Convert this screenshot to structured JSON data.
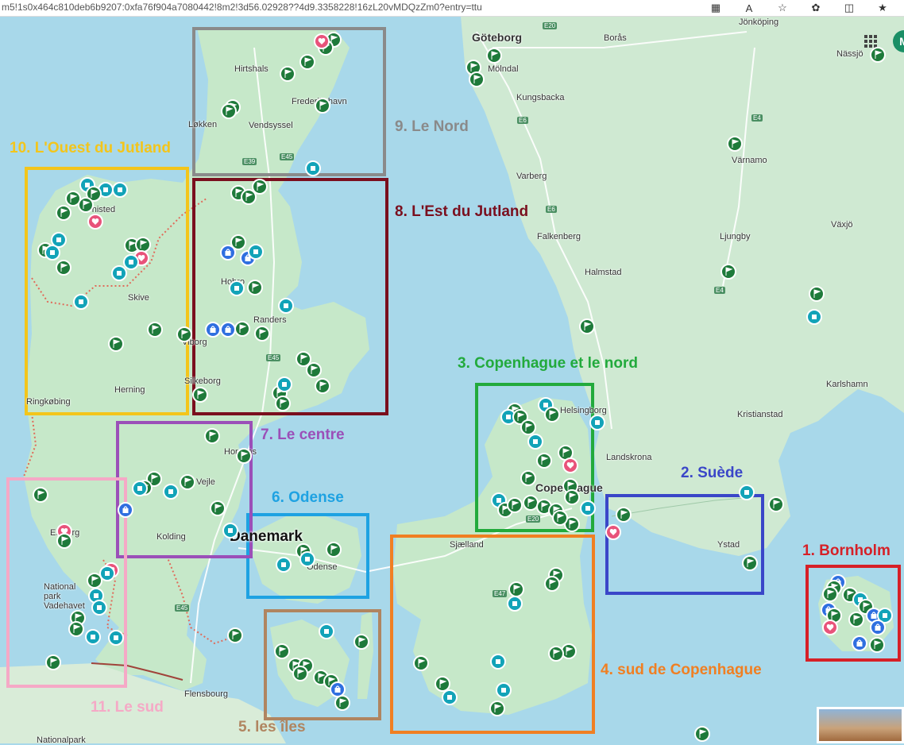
{
  "browser": {
    "url": "m5!1s0x464c810deb6b9207:0xfa76f904a7080442!8m2!3d56.02928??4d9.3358228!16zL20vMDQzZm0?entry=ttu"
  },
  "map": {
    "country_label": "Danemark",
    "avatar_letter": "M",
    "colors": {
      "sea": "#a8d8ea",
      "land": "#c6e8c9",
      "sweden_land": "#cfe9d2",
      "marker_green": "#1e7a3a",
      "marker_teal": "#12a3b8",
      "marker_blue": "#2f6fe0",
      "marker_pink": "#e8537a"
    },
    "regions": [
      {
        "id": "r1",
        "label": "1. Bornholm",
        "color": "#d62027"
      },
      {
        "id": "r2",
        "label": "2. Suède",
        "color": "#3a46c8"
      },
      {
        "id": "r3",
        "label": "3. Copenhague et le nord",
        "color": "#22aa3c"
      },
      {
        "id": "r4",
        "label": "4. sud de Copenhague",
        "color": "#f07f22"
      },
      {
        "id": "r5",
        "label": "5. les îles",
        "color": "#b08560"
      },
      {
        "id": "r6",
        "label": "6. Odense",
        "color": "#1ea2e2"
      },
      {
        "id": "r7",
        "label": "7. Le centre",
        "color": "#9b4fb8"
      },
      {
        "id": "r8",
        "label": "8. L'Est du Jutland",
        "color": "#7a0f1e"
      },
      {
        "id": "r9",
        "label": "9. Le Nord",
        "color": "#8a8a8a"
      },
      {
        "id": "r10",
        "label": "10. L'Ouest du Jutland",
        "color": "#f3c51b"
      },
      {
        "id": "r11",
        "label": "11. Le sud",
        "color": "#f5a9c6"
      }
    ],
    "places": [
      {
        "id": "p1",
        "name": "Göteborg"
      },
      {
        "id": "p2",
        "name": "Borås"
      },
      {
        "id": "p3",
        "name": "Jönköping"
      },
      {
        "id": "p4",
        "name": "Mölndal"
      },
      {
        "id": "p5",
        "name": "Kungsbacka"
      },
      {
        "id": "p6",
        "name": "Nässjö"
      },
      {
        "id": "p7",
        "name": "Hirtshals"
      },
      {
        "id": "p8",
        "name": "Frederikshavn"
      },
      {
        "id": "p9",
        "name": "Vendsyssel"
      },
      {
        "id": "p10",
        "name": "Løkken"
      },
      {
        "id": "p11",
        "name": "Varberg"
      },
      {
        "id": "p12",
        "name": "Värnamo"
      },
      {
        "id": "p13",
        "name": "Falkenberg"
      },
      {
        "id": "p14",
        "name": "Ljungby"
      },
      {
        "id": "p15",
        "name": "Växjö"
      },
      {
        "id": "p16",
        "name": "Halmstad"
      },
      {
        "id": "p17",
        "name": "Skive"
      },
      {
        "id": "p18",
        "name": "Viborg"
      },
      {
        "id": "p19",
        "name": "Randers"
      },
      {
        "id": "p20",
        "name": "Hobro"
      },
      {
        "id": "p21",
        "name": "Herning"
      },
      {
        "id": "p22",
        "name": "Ringkøbing"
      },
      {
        "id": "p23",
        "name": "Silkeborg"
      },
      {
        "id": "p24",
        "name": "Karlshamn"
      },
      {
        "id": "p25",
        "name": "Kristianstad"
      },
      {
        "id": "p26",
        "name": "Helsingborg"
      },
      {
        "id": "p27",
        "name": "Landskrona"
      },
      {
        "id": "p28",
        "name": "Copenhague"
      },
      {
        "id": "p29",
        "name": "Horsens"
      },
      {
        "id": "p30",
        "name": "Vejle"
      },
      {
        "id": "p31",
        "name": "Kolding"
      },
      {
        "id": "p32",
        "name": "Esbjerg"
      },
      {
        "id": "p33",
        "name": "Odense"
      },
      {
        "id": "p34",
        "name": "Sjælland"
      },
      {
        "id": "p35",
        "name": "Ystad"
      },
      {
        "id": "p36",
        "name": "National park Vadehavet"
      },
      {
        "id": "p37",
        "name": "Flensbourg"
      },
      {
        "id": "p38",
        "name": "Nationalpark"
      },
      {
        "id": "p39",
        "name": "Thisted"
      }
    ],
    "roads": [
      "E20",
      "E6",
      "E4",
      "E45",
      "E39",
      "E47"
    ],
    "markers_legend": [
      "flag-icon",
      "pin-icon",
      "heart-icon",
      "shopping-bag-icon"
    ]
  }
}
